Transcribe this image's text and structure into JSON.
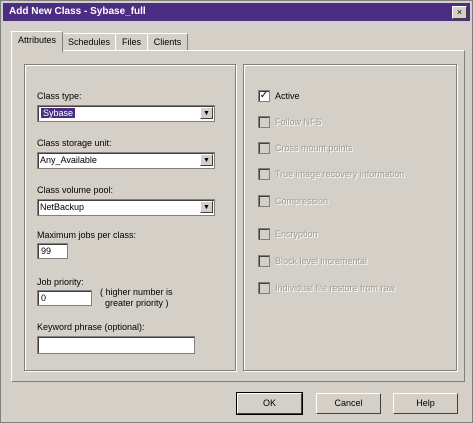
{
  "window": {
    "title": "Add New Class - Sybase_full",
    "close_glyph": "×"
  },
  "tabs": [
    {
      "label": "Attributes",
      "active": true
    },
    {
      "label": "Schedules",
      "active": false
    },
    {
      "label": "Files",
      "active": false
    },
    {
      "label": "Clients",
      "active": false
    }
  ],
  "left": {
    "class_type_label": "Class type:",
    "class_type_value": "Sybase",
    "storage_unit_label": "Class storage unit:",
    "storage_unit_value": "Any_Available",
    "volume_pool_label": "Class volume pool:",
    "volume_pool_value": "NetBackup",
    "max_jobs_label": "Maximum jobs per class:",
    "max_jobs_value": "99",
    "job_priority_label": "Job priority:",
    "job_priority_value": "0",
    "priority_hint_line1": "( higher number is",
    "priority_hint_line2": "greater priority )",
    "keyword_label": "Keyword phrase (optional):",
    "keyword_value": "",
    "dropdown_glyph": "▼"
  },
  "right": {
    "check_glyph": "✓",
    "checkboxes": [
      {
        "label": "Active",
        "checked": true,
        "enabled": true
      },
      {
        "label": "Follow NFS",
        "checked": false,
        "enabled": false
      },
      {
        "label": "Cross mount points",
        "checked": false,
        "enabled": false
      },
      {
        "label": "True image recovery information",
        "checked": false,
        "enabled": false
      },
      {
        "label": "Compression",
        "checked": false,
        "enabled": false
      },
      {
        "label": "Encryption",
        "checked": false,
        "enabled": false
      },
      {
        "label": "Block level incremental",
        "checked": false,
        "enabled": false
      },
      {
        "label": "Individual file restore from raw",
        "checked": false,
        "enabled": false
      }
    ]
  },
  "buttons": {
    "ok": "OK",
    "cancel": "Cancel",
    "help": "Help"
  },
  "colors": {
    "titlebar": "#4b2e83",
    "face": "#d4d0c8",
    "disabled_text": "#a09c94"
  }
}
